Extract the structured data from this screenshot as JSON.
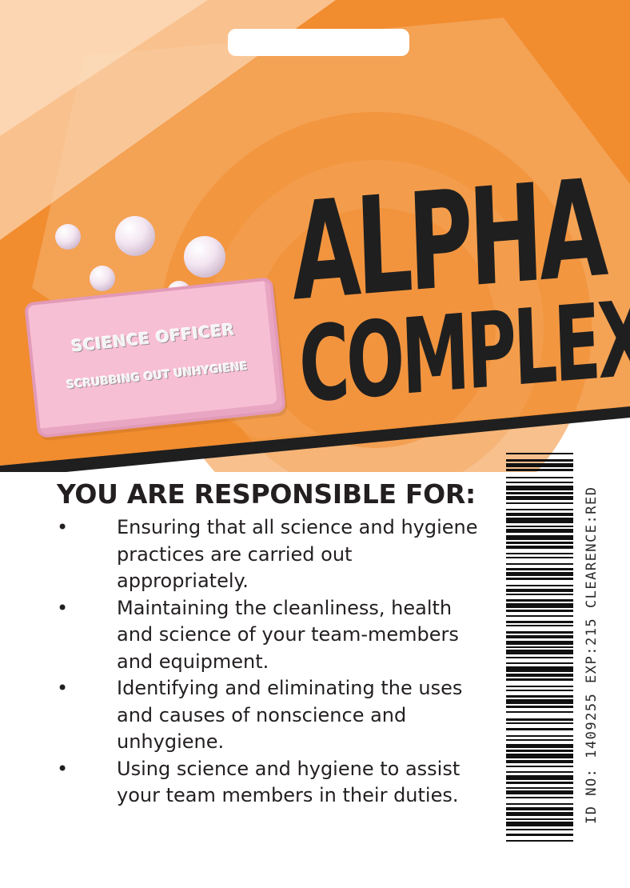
{
  "card": {
    "title_line1": "ALPHA",
    "title_line2": "COMPLEX",
    "colors": {
      "orange": "#f18c2f",
      "light_orange": "#f5a65a",
      "pale_orange": "#fbd3ad",
      "stripe": "#1f1f1f",
      "soap_pink": "#f7bfd4"
    }
  },
  "soap": {
    "line1": "SCIENCE OFFICER",
    "line2": "SCRUBBING OUT UNHYGIENE"
  },
  "responsibilities": {
    "heading": "YOU ARE RESPONSIBLE FOR:",
    "bullet": "•",
    "items": [
      "Ensuring that all science and hygiene practices are carried out appropriately.",
      "Maintaining the cleanliness, health and science of your team-members and equipment.",
      "Identifying and eliminating the uses and causes of nonscience and unhygiene.",
      "Using science and hygiene to assist your team members in their duties."
    ]
  },
  "id_strip": {
    "text": "ID NO: 1409255 EXP:215 CLEARENCE:RED"
  },
  "icons": [
    "bubble-icon",
    "soap-bar-icon",
    "barcode-icon",
    "lanyard-slot"
  ]
}
